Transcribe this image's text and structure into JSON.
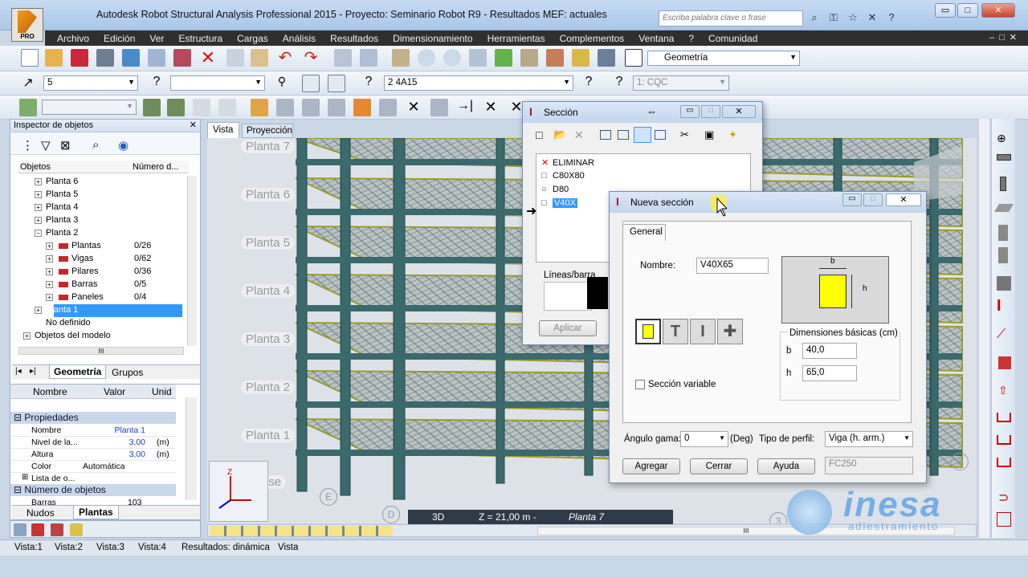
{
  "window": {
    "title": "Autodesk Robot Structural Analysis Professional 2015 - Proyecto: Seminario Robot R9 - Resultados MEF: actuales",
    "logo_text": "PRO",
    "search_placeholder": "Escriba palabra clave o frase",
    "minimize": "▭",
    "maximize": "□",
    "close": "✕"
  },
  "menu": [
    "Archivo",
    "Edición",
    "Ver",
    "Estructura",
    "Cargas",
    "Análisis",
    "Resultados",
    "Dimensionamiento",
    "Herramientas",
    "Complementos",
    "Ventana",
    "?",
    "Comunidad"
  ],
  "toolbar": {
    "layout_combo": "Geometría",
    "combo_node": "5",
    "combo_empty": "",
    "combo_section": "2 4A15",
    "combo_case": "1: CQC"
  },
  "inspector": {
    "title": "Inspector de objetos",
    "col_objects": "Objetos",
    "col_number": "Número d...",
    "tree": [
      {
        "label": "Planta 6",
        "indent": 1,
        "pm": "+",
        "count": ""
      },
      {
        "label": "Planta 5",
        "indent": 1,
        "pm": "+",
        "count": ""
      },
      {
        "label": "Planta 4",
        "indent": 1,
        "pm": "+",
        "count": ""
      },
      {
        "label": "Planta 3",
        "indent": 1,
        "pm": "+",
        "count": ""
      },
      {
        "label": "Planta 2",
        "indent": 1,
        "pm": "−",
        "count": ""
      },
      {
        "label": "Plantas",
        "indent": 2,
        "pm": "+",
        "count": "0/26"
      },
      {
        "label": "Vigas",
        "indent": 2,
        "pm": "+",
        "count": "0/62"
      },
      {
        "label": "Pilares",
        "indent": 2,
        "pm": "+",
        "count": "0/36"
      },
      {
        "label": "Barras",
        "indent": 2,
        "pm": "+",
        "count": "0/5"
      },
      {
        "label": "Paneles",
        "indent": 2,
        "pm": "+",
        "count": "0/4"
      },
      {
        "label": "Planta 1",
        "indent": 1,
        "pm": "+",
        "count": ""
      },
      {
        "label": "No definido",
        "indent": 1,
        "pm": "",
        "count": ""
      },
      {
        "label": "Objetos del modelo",
        "indent": 0,
        "pm": "+",
        "count": ""
      }
    ],
    "tabs": [
      "Geometría",
      "Grupos"
    ]
  },
  "properties": {
    "headers": [
      "Nombre",
      "Valor",
      "Unid"
    ],
    "group1": "Propiedades",
    "rows": [
      {
        "name": "Nombre",
        "value": "Planta 1",
        "unit": ""
      },
      {
        "name": "Nivel de la...",
        "value": "3,00",
        "unit": "(m)"
      },
      {
        "name": "Altura",
        "value": "3,00",
        "unit": "(m)"
      },
      {
        "name": "Color",
        "value": "Automática",
        "unit": ""
      },
      {
        "name": "Lista de o...",
        "value": "",
        "unit": ""
      }
    ],
    "group2": "Número de objetos",
    "row_bars": {
      "name": "Barras",
      "value": "103"
    },
    "tabs": [
      "Nudos",
      "Plantas"
    ]
  },
  "view": {
    "tabs": [
      "Vista",
      "Proyección"
    ],
    "floor_labels": [
      "Planta 7",
      "Planta 6",
      "Planta 5",
      "Planta 4",
      "Planta 3",
      "Planta 2",
      "Planta 1",
      "Base"
    ],
    "mode": "3D",
    "level_text": "Z = 21,00 m - ",
    "level_floor": "Planta 7",
    "axis_e": "E",
    "axis_d": "D",
    "axis_6": "6",
    "axis_3": "3"
  },
  "statusbar": [
    "Vista:1",
    "Vista:2",
    "Vista:3",
    "Vista:4",
    "Resultados: dinámica",
    "Vista"
  ],
  "seccion_dialog": {
    "title": "Sección",
    "list": [
      {
        "label": "ELIMINAR",
        "mark": "✕"
      },
      {
        "label": "C80X80",
        "mark": "□"
      },
      {
        "label": "D80",
        "mark": "○"
      },
      {
        "label": "V40X",
        "mark": "□"
      }
    ],
    "lines_label": "Líneas/barra",
    "apply": "Aplicar"
  },
  "nueva_dialog": {
    "title": "Nueva sección",
    "tab": "General",
    "name_label": "Nombre:",
    "name_value": "V40X65",
    "dim_b_tag": "b",
    "dim_h_tag": "h",
    "variable": "Sección variable",
    "dims_title": "Dimensiones básicas (cm)",
    "b_label": "b",
    "b_value": "40,0",
    "h_label": "h",
    "h_value": "65,0",
    "gamma_label": "Ángulo gama:",
    "gamma_value": "0",
    "gamma_unit": "(Deg)",
    "profile_label": "Tipo de perfil:",
    "profile_value": "Viga (h. arm.)",
    "add": "Agregar",
    "close": "Cerrar",
    "help": "Ayuda",
    "material": "FC250"
  },
  "watermark": {
    "brand": "inesa",
    "sub": "adiestramiento"
  },
  "colors": {
    "accent": "#3399ff",
    "menubar": "#2f2f2f",
    "section_fill": "#ffff00"
  }
}
